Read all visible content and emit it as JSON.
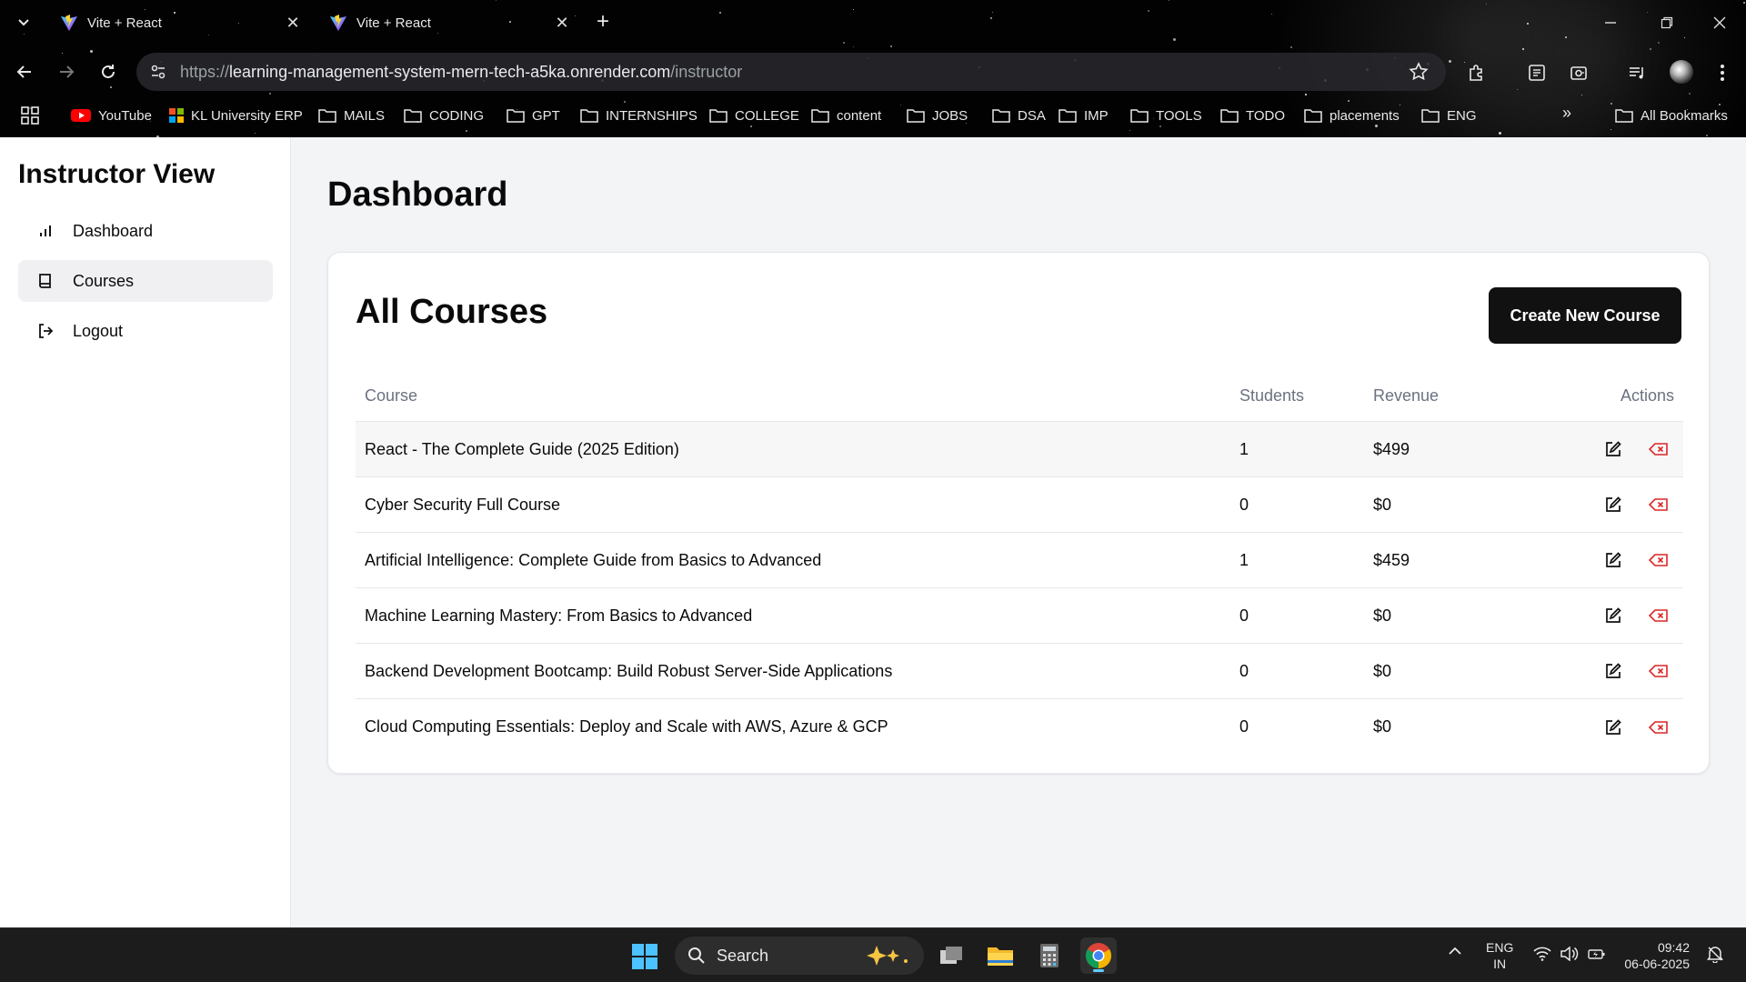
{
  "browser": {
    "tabs": [
      {
        "title": "Vite + React"
      },
      {
        "title": "Vite + React"
      }
    ],
    "url": {
      "scheme": "https://",
      "host": "learning-management-system-mern-tech-a5ka.onrender.com",
      "path": "/instructor"
    },
    "bookmarks": [
      {
        "label": "YouTube",
        "icon": "youtube-icon"
      },
      {
        "label": "KL University ERP",
        "icon": "erp-icon"
      },
      {
        "label": "MAILS",
        "icon": "folder-icon"
      },
      {
        "label": "CODING",
        "icon": "folder-icon"
      },
      {
        "label": "GPT",
        "icon": "folder-icon"
      },
      {
        "label": "INTERNSHIPS",
        "icon": "folder-icon"
      },
      {
        "label": "COLLEGE",
        "icon": "folder-icon"
      },
      {
        "label": "content",
        "icon": "folder-icon"
      },
      {
        "label": "JOBS",
        "icon": "folder-icon"
      },
      {
        "label": "DSA",
        "icon": "folder-icon"
      },
      {
        "label": "IMP",
        "icon": "folder-icon"
      },
      {
        "label": "TOOLS",
        "icon": "folder-icon"
      },
      {
        "label": "TODO",
        "icon": "folder-icon"
      },
      {
        "label": "placements",
        "icon": "folder-icon"
      },
      {
        "label": "ENG",
        "icon": "folder-icon"
      }
    ],
    "all_bookmarks_label": "All Bookmarks"
  },
  "sidebar": {
    "title": "Instructor View",
    "items": [
      {
        "label": "Dashboard",
        "icon": "bar-chart-icon",
        "active": false
      },
      {
        "label": "Courses",
        "icon": "book-icon",
        "active": true
      },
      {
        "label": "Logout",
        "icon": "logout-icon",
        "active": false
      }
    ]
  },
  "main": {
    "page_title": "Dashboard",
    "card_title": "All Courses",
    "create_button": "Create New Course",
    "columns": {
      "course": "Course",
      "students": "Students",
      "revenue": "Revenue",
      "actions": "Actions"
    },
    "rows": [
      {
        "course": "React - The Complete Guide (2025 Edition)",
        "students": "1",
        "revenue": "$499"
      },
      {
        "course": "Cyber Security Full Course",
        "students": "0",
        "revenue": "$0"
      },
      {
        "course": "Artificial Intelligence: Complete Guide from Basics to Advanced",
        "students": "1",
        "revenue": "$459"
      },
      {
        "course": "Machine Learning Mastery: From Basics to Advanced",
        "students": "0",
        "revenue": "$0"
      },
      {
        "course": "Backend Development Bootcamp: Build Robust Server-Side Applications",
        "students": "0",
        "revenue": "$0"
      },
      {
        "course": "Cloud Computing Essentials: Deploy and Scale with AWS, Azure & GCP",
        "students": "0",
        "revenue": "$0"
      }
    ],
    "delete_color": "#dc2626"
  },
  "taskbar": {
    "search_placeholder": "Search",
    "lang_top": "ENG",
    "lang_bottom": "IN",
    "time": "09:42",
    "date": "06-06-2025"
  }
}
